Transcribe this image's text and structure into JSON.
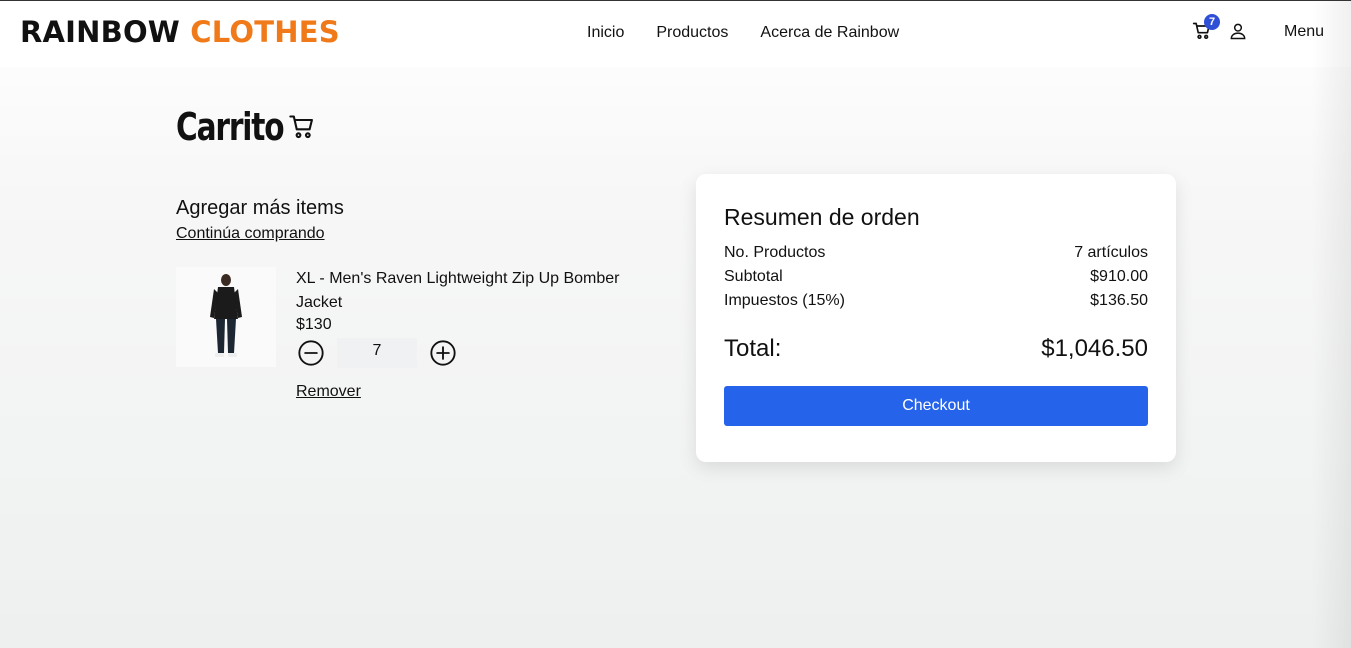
{
  "header": {
    "logo_part1": "RAINBOW",
    "logo_part2": "CLOTHES",
    "nav": [
      "Inicio",
      "Productos",
      "Acerca de Rainbow"
    ],
    "cart_count": "7",
    "menu_label": "Menu"
  },
  "page": {
    "title": "Carrito",
    "add_more": "Agregar más items",
    "continue_link": "Continúa comprando"
  },
  "cart_items": [
    {
      "name": "XL - Men's Raven Lightweight Zip Up Bomber Jacket",
      "price": "$130",
      "quantity": "7",
      "remove_label": "Remover"
    }
  ],
  "summary": {
    "title": "Resumen de orden",
    "products_label": "No. Productos",
    "products_value": "7 artículos",
    "subtotal_label": "Subtotal",
    "subtotal_value": "$910.00",
    "tax_label": "Impuestos (15%)",
    "tax_value": "$136.50",
    "total_label": "Total:",
    "total_value": "$1,046.50",
    "checkout_label": "Checkout"
  },
  "colors": {
    "brand_orange": "#f07a1a",
    "badge_blue": "#2f4fd6",
    "checkout_blue": "#2563eb"
  },
  "icons": [
    "cart-icon",
    "user-icon",
    "minus-circle-icon",
    "plus-circle-icon"
  ]
}
